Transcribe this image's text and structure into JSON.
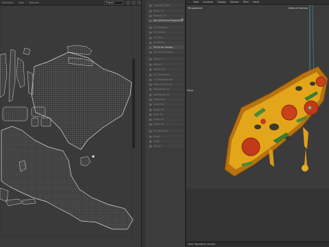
{
  "uv_editor": {
    "menu": [
      "Selection",
      "View",
      "Textures"
    ],
    "projection_select": "Project"
  },
  "tool_panel": {
    "items": [
      {
        "label": "Optimal Cubic",
        "highlight": false
      },
      {
        "label": "Relax UV",
        "highlight": false
      },
      {
        "label": "Realign UV",
        "highlight": false
      },
      {
        "label": "Set UVW from Projection",
        "highlight": true
      },
      {
        "label": "UV Mapping",
        "highlight": false
      },
      {
        "label": "UV Islands",
        "highlight": false
      },
      {
        "label": "UV Pack",
        "highlight": false
      },
      {
        "label": "UV Terrain",
        "highlight": false
      },
      {
        "label": "Fit UV to Canvas",
        "highlight": true
      },
      {
        "label": "Fit UV to Canvas",
        "highlight": false
      },
      {
        "label": "Mirror U",
        "highlight": false
      },
      {
        "label": "Mirror V",
        "highlight": false
      },
      {
        "label": "Rotate UV",
        "highlight": false
      },
      {
        "label": "UV Transform",
        "highlight": false
      },
      {
        "label": "UV Manipulation",
        "highlight": false
      },
      {
        "label": "Align UV Islands",
        "highlight": false
      },
      {
        "label": "Straighten UV",
        "highlight": false
      },
      {
        "label": "Normalize UV",
        "highlight": false
      },
      {
        "label": "Project UV",
        "highlight": false
      },
      {
        "label": "Scale UV",
        "highlight": false
      },
      {
        "label": "Angle UV",
        "highlight": false
      },
      {
        "label": "Shift UV",
        "highlight": false
      },
      {
        "label": "Scale UV",
        "highlight": false
      },
      {
        "label": "Scale UV",
        "highlight": false
      },
      {
        "label": "UV Selection",
        "highlight": false
      },
      {
        "label": "Invert",
        "highlight": false
      },
      {
        "label": "Grow",
        "highlight": false
      },
      {
        "label": "Shrink",
        "highlight": false
      }
    ]
  },
  "viewport": {
    "menu": [
      "View",
      "Cameras",
      "Display",
      "Options",
      "Filter",
      "Panel"
    ],
    "perspective_label": "Perspective",
    "camera_label": "Default Camera",
    "mode_label": "Move",
    "status": "View Transform: Screen"
  }
}
